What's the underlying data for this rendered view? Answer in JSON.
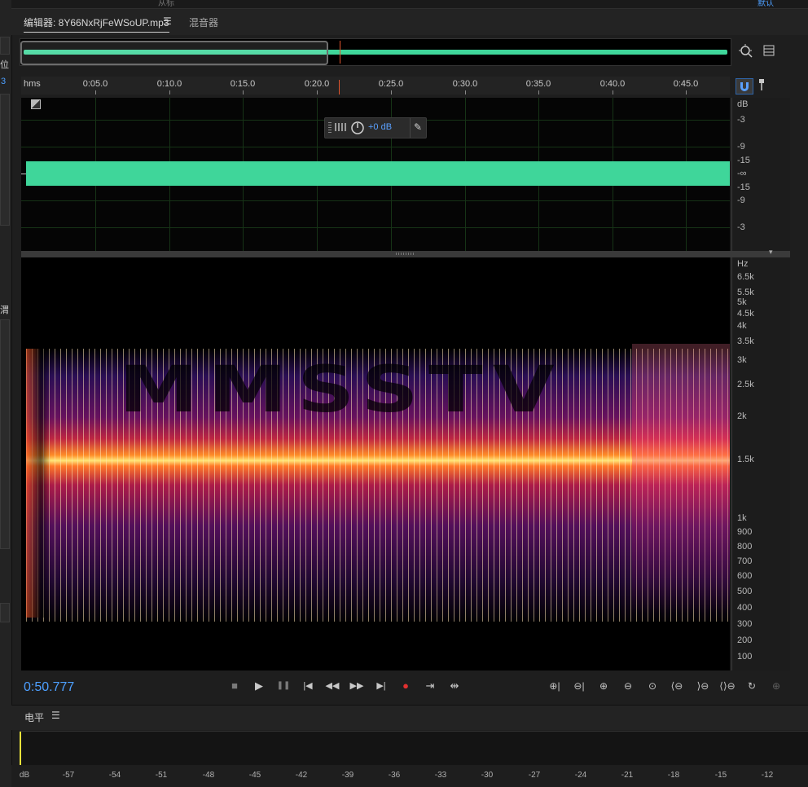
{
  "left_panel": {
    "label_a": "位",
    "label_b": "3",
    "label_c": "渭"
  },
  "top_strip": {
    "left_text": "从标",
    "right_text": "默认"
  },
  "tabs": {
    "editor": "编辑器: 8Y66NxRjFeWSoUP.mp3",
    "menu": "☰",
    "mixer": "混音器"
  },
  "icons": {
    "zoom_fit": "zoom-to-fit-icon",
    "panel_menu": "panel-list-icon",
    "snap": "magnet-snap-icon",
    "marker": "pin-marker-icon"
  },
  "ruler": {
    "unit": "hms",
    "ticks": [
      "0:05.0",
      "0:10.0",
      "0:15.0",
      "0:20.0",
      "0:25.0",
      "0:30.0",
      "0:35.0",
      "0:40.0",
      "0:45.0"
    ]
  },
  "waveform": {
    "hud_gain": "+0 dB",
    "db_unit": "dB",
    "db_labels": [
      "-3",
      "-9",
      "-15",
      "-∞",
      "-15",
      "-9",
      "-3"
    ],
    "color": "#3fd69a"
  },
  "spectrogram": {
    "overlay_text": "MMSSTV",
    "hz_unit": "Hz",
    "hz_labels": [
      "6.5k",
      "5.5k",
      "5k",
      "4.5k",
      "4k",
      "3.5k",
      "3k",
      "2.5k",
      "2k",
      "1.5k",
      "1k",
      "900",
      "800",
      "700",
      "600",
      "500",
      "400",
      "300",
      "200",
      "100"
    ]
  },
  "transport": {
    "time": "0:50.777",
    "buttons": [
      "■",
      "▶",
      "❚❚",
      "|◀",
      "◀◀",
      "▶▶",
      "▶|",
      "●",
      "⇥",
      "⇹"
    ]
  },
  "zoom_tools": [
    "⊕|",
    "⊖|",
    "⊕",
    "⊖",
    "⊙",
    "⟨⊖",
    "⟩⊖",
    "⟨⟩⊖",
    "↻",
    "⊕"
  ],
  "levels": {
    "title": "电平",
    "menu": "☰",
    "unit": "dB",
    "scale": [
      "-57",
      "-54",
      "-51",
      "-48",
      "-45",
      "-42",
      "-39",
      "-36",
      "-33",
      "-30",
      "-27",
      "-24",
      "-21",
      "-18",
      "-15",
      "-12"
    ]
  }
}
